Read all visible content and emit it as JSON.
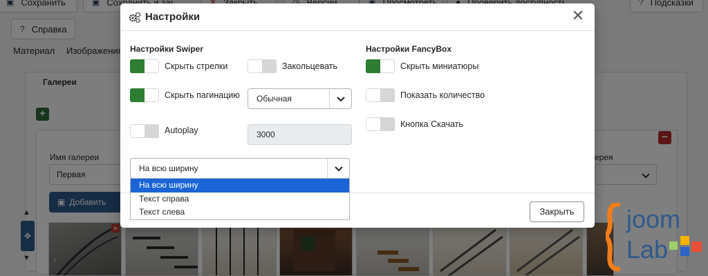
{
  "toolbar": {
    "save": "Сохранить",
    "save_close": "Сохранить и закрыть",
    "close": "Закрыть",
    "versions": "Версии",
    "preview": "Просмотреть",
    "check_access": "Проверить доступность",
    "help_hints": "Подсказки",
    "help": "Справка"
  },
  "tabs": [
    "Материал",
    "Изображения и"
  ],
  "background": {
    "legend": "Галереи",
    "gallery_name_label": "Имя галереи",
    "gallery_name_value": "Первая",
    "right_label": "ерея",
    "add_image": "Добавить"
  },
  "modal": {
    "title": "Настройки",
    "swiper": {
      "title": "Настройки Swiper",
      "hide_arrows": "Скрыть стрелки",
      "hide_pagination": "Скрыть пагинацию",
      "autoplay": "Autoplay",
      "loop": "Закольцевать",
      "pagination_type": "Обычная",
      "autoplay_delay": "3000",
      "width_select": "На всю ширину",
      "width_options": [
        "На всю ширину",
        "Текст справа",
        "Текст слева"
      ]
    },
    "fancybox": {
      "title": "Настройки FancyBox",
      "hide_thumbs": "Скрыть миниатюры",
      "show_count": "Показать количество",
      "download_button": "Кнопка Скачать"
    },
    "close_button": "Закрыть"
  },
  "toggles": {
    "hide_arrows": true,
    "hide_pagination": true,
    "autoplay": false,
    "loop": false,
    "hide_thumbs": true,
    "show_count": false,
    "download_button": false
  },
  "logo": {
    "line1": "joom",
    "line2": "Lab"
  },
  "colors": {
    "accent_green": "#2d7d32",
    "selected_option": "#1a64d6",
    "primary_blue": "#2e5a8c",
    "danger_red": "#b42b2f"
  }
}
